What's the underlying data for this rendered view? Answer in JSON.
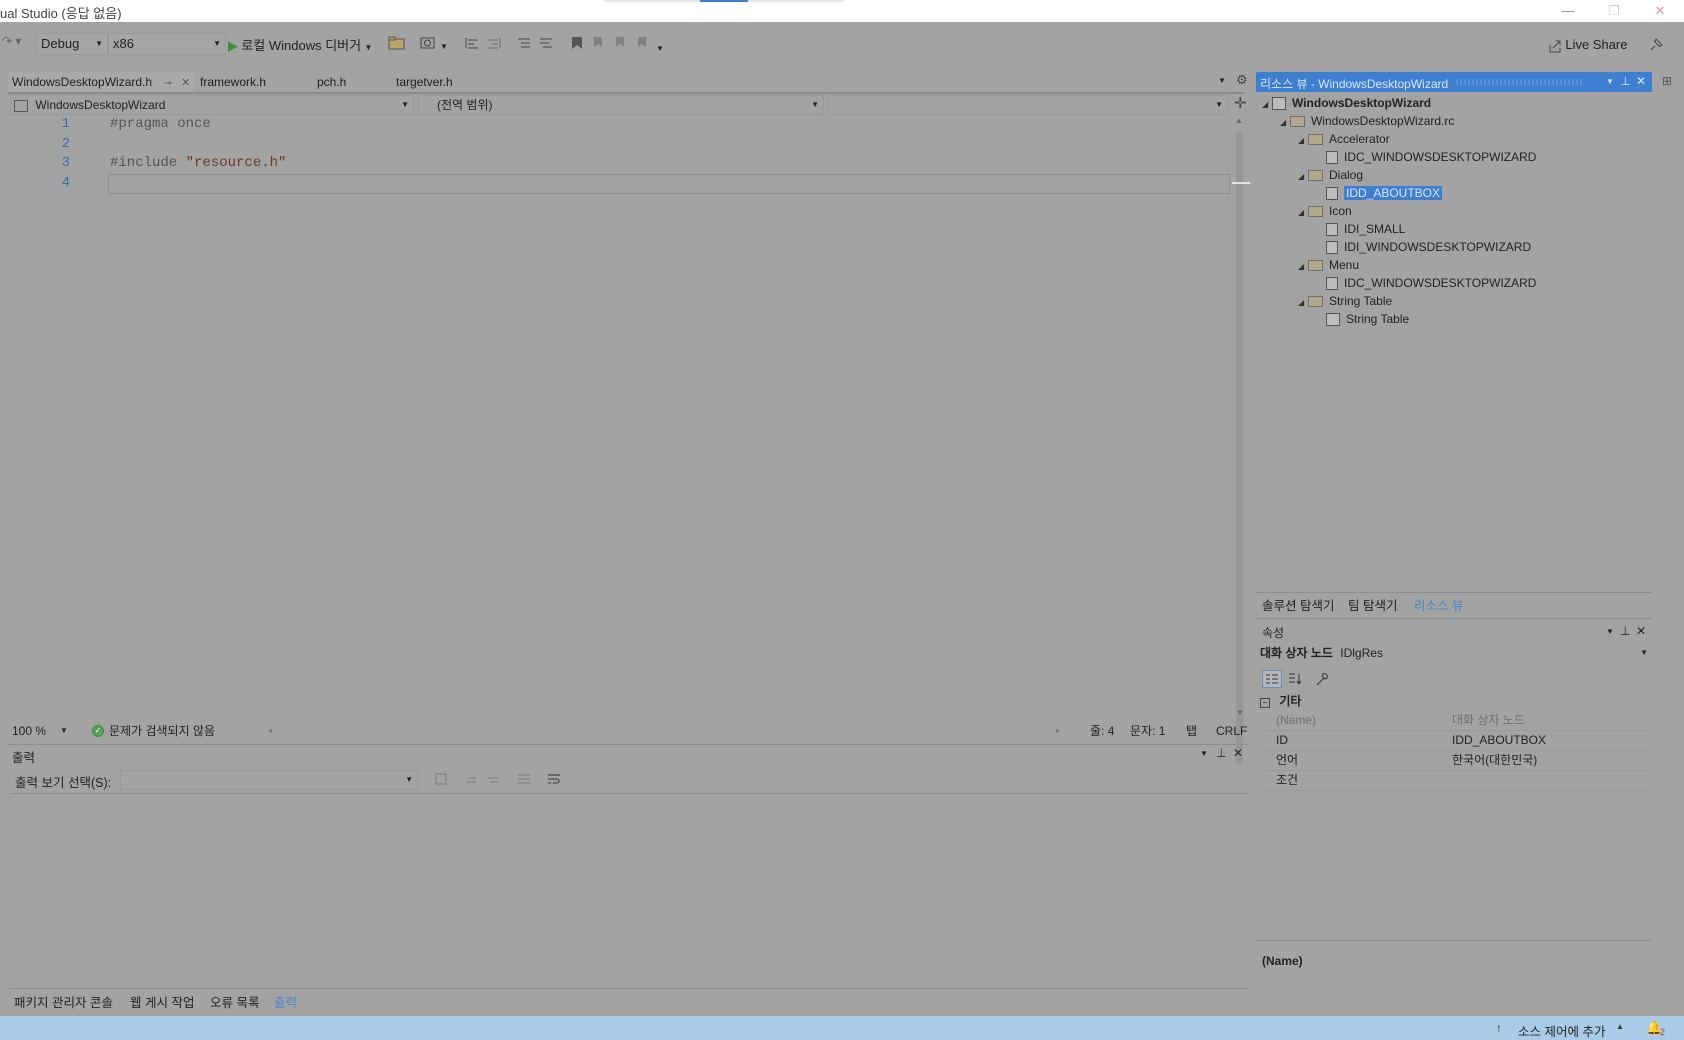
{
  "window": {
    "title": "ual Studio (응답 없음)",
    "minimize_icon": "—",
    "maximize_icon": "❐",
    "close_icon": "✕"
  },
  "toolbar": {
    "config": "Debug",
    "platform": "x86",
    "debugger": "로컬 Windows 디버거",
    "live_share": "Live Share"
  },
  "editor": {
    "tabs": [
      {
        "label": "WindowsDesktopWizard.h",
        "active": true
      },
      {
        "label": "framework.h"
      },
      {
        "label": "pch.h"
      },
      {
        "label": "targetver.h"
      }
    ],
    "nav_project": "WindowsDesktopWizard",
    "nav_scope": "(전역 범위)",
    "lines": [
      {
        "num": "1",
        "text": "#pragma once"
      },
      {
        "num": "2",
        "text": ""
      },
      {
        "num": "3",
        "text": "#include ",
        "string": "\"resource.h\""
      },
      {
        "num": "4",
        "text": ""
      }
    ],
    "zoom": "100 %",
    "no_issues": "문제가 검색되지 않음",
    "line_info": "줄: 4",
    "char_info": "문자: 1",
    "tab_info": "탭",
    "eol": "CRLF"
  },
  "output": {
    "title": "출력",
    "source_label": "출력 보기 선택(S):",
    "bottom_tabs": [
      {
        "label": "패키지 관리자 콘솔"
      },
      {
        "label": "웹 게시 작업"
      },
      {
        "label": "오류 목록"
      },
      {
        "label": "출력",
        "active": true
      }
    ]
  },
  "resource_view": {
    "title": "리소스 뷰 - WindowsDesktopWizard",
    "root": "WindowsDesktopWizard",
    "rc": "WindowsDesktopWizard.rc",
    "folders": [
      {
        "name": "Accelerator",
        "items": [
          "IDC_WINDOWSDESKTOPWIZARD"
        ]
      },
      {
        "name": "Dialog",
        "items": [
          "IDD_ABOUTBOX"
        ]
      },
      {
        "name": "Icon",
        "items": [
          "IDI_SMALL",
          "IDI_WINDOWSDESKTOPWIZARD"
        ]
      },
      {
        "name": "Menu",
        "items": [
          "IDC_WINDOWSDESKTOPWIZARD"
        ]
      },
      {
        "name": "String Table",
        "items": [
          "String Table"
        ]
      }
    ],
    "selected": "IDD_ABOUTBOX",
    "tabs": [
      {
        "label": "솔루션 탐색기"
      },
      {
        "label": "팀 탐색기"
      },
      {
        "label": "리소스 뷰",
        "active": true
      }
    ]
  },
  "properties": {
    "title": "속성",
    "object": "대화 상자 노드",
    "object_type": "IDlgRes",
    "category": "기타",
    "rows": [
      {
        "name": "(Name)",
        "value": "대화 상자 노드",
        "muted": true
      },
      {
        "name": "ID",
        "value": "IDD_ABOUTBOX"
      },
      {
        "name": "언어",
        "value": "한국어(대한민국)"
      },
      {
        "name": "조건",
        "value": ""
      }
    ],
    "description_title": "(Name)"
  },
  "statusbar": {
    "source_control": "소스 제어에 추가",
    "notifications": "2"
  }
}
